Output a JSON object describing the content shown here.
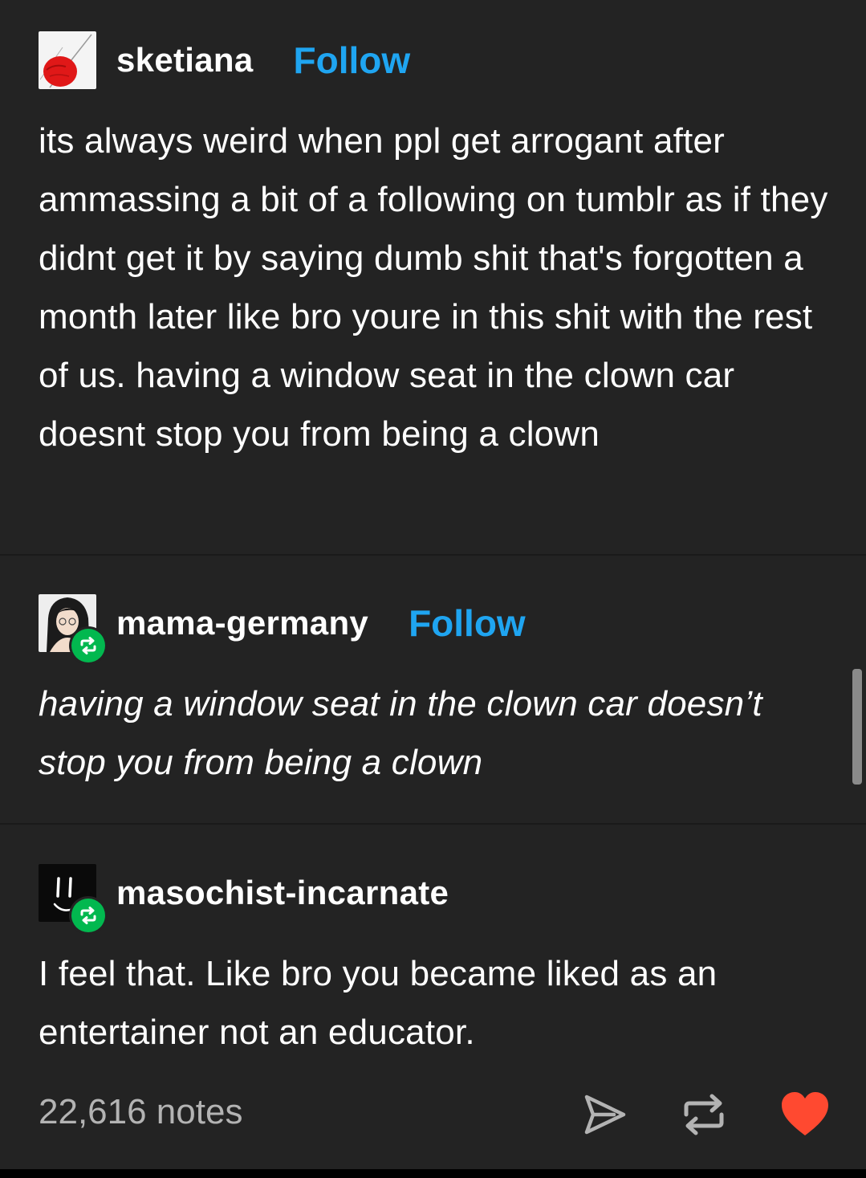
{
  "posts": [
    {
      "username": "sketiana",
      "follow_label": "Follow",
      "text": "its always weird when ppl get arrogant after ammassing a bit of a following on tumblr as if they didnt get it by saying dumb shit that's forgotten a month later like bro youre in this shit with the rest of us. having a window seat in the clown car doesnt stop you from being a clown"
    },
    {
      "username": "mama-germany",
      "follow_label": "Follow",
      "text": "having a window seat in the clown car doesn’t stop you from being a clown"
    },
    {
      "username": "masochist-incarnate",
      "text": "I feel that. Like bro you became liked as an entertainer not an educator."
    }
  ],
  "footer": {
    "notes": "22,616 notes"
  },
  "colors": {
    "background": "#232323",
    "follow": "#1fa5f1",
    "reblog_badge": "#02b84f",
    "like": "#ff4930",
    "notes_text": "#b3b3b3"
  },
  "icons": {
    "share": "send-icon",
    "reblog": "reblog-icon",
    "like": "heart-icon"
  }
}
